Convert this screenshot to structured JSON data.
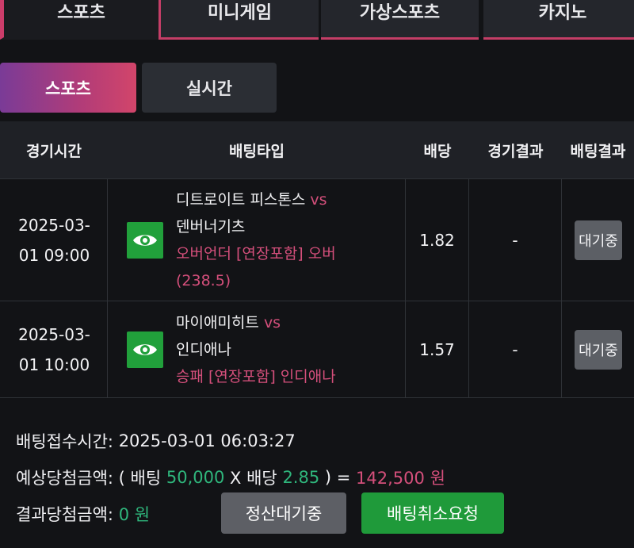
{
  "top_tabs": [
    "스포츠",
    "미니게임",
    "가상스포츠",
    "카지노"
  ],
  "sub_tabs": [
    "스포츠",
    "실시간"
  ],
  "table": {
    "headers": [
      "경기시간",
      "배팅타입",
      "배당",
      "경기결과",
      "배팅결과"
    ],
    "rows": [
      {
        "time_line1": "2025-03-",
        "time_line2": "01 09:00",
        "home": "디트로이트 피스톤스",
        "vs": "vs",
        "away": "덴버너기츠",
        "market": "오버언더 [연장포함] 오버",
        "market_extra": "(238.5)",
        "odds": "1.82",
        "result": "-",
        "status": "대기중"
      },
      {
        "time_line1": "2025-03-",
        "time_line2": "01 10:00",
        "home": "마이애미히트",
        "vs": "vs",
        "away": "인디애나",
        "market": "승패 [연장포함] 인디애나",
        "market_extra": "",
        "odds": "1.57",
        "result": "-",
        "status": "대기중"
      }
    ]
  },
  "summary": {
    "bet_time_label": "배팅접수시간:",
    "bet_time_value": "2025-03-01 06:03:27",
    "expected_label": "예상당첨금액: ( 배팅",
    "bet_amount": "50,000",
    "x_label": "X 배당",
    "total_odds": "2.85",
    "close_eq": ") =",
    "expected_amount": "142,500 원",
    "result_label": "결과당첨금액:",
    "result_amount": "0 원"
  },
  "buttons": {
    "settle": "정산대기중",
    "cancel": "배팅취소요청"
  },
  "colors": {
    "accent_pink": "#d44f7b",
    "green": "#2fb67c",
    "eye_button": "#21a03b"
  }
}
